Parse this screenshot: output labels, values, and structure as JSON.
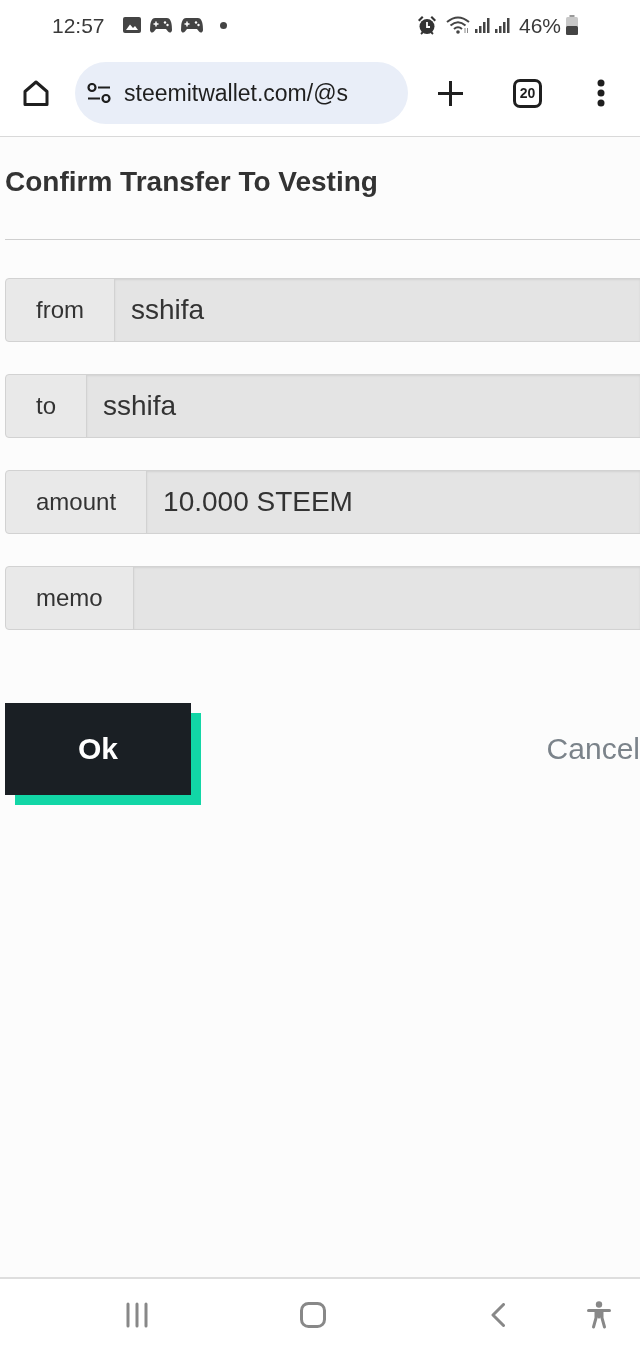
{
  "status_bar": {
    "time": "12:57",
    "battery": "46%"
  },
  "browser_toolbar": {
    "url": "steemitwallet.com/@s",
    "tab_count": "20"
  },
  "dialog": {
    "title": "Confirm Transfer To Vesting",
    "fields": [
      {
        "label": "from",
        "value": "sshifa"
      },
      {
        "label": "to",
        "value": "sshifa"
      },
      {
        "label": "amount",
        "value": "10.000 STEEM"
      },
      {
        "label": "memo"
      }
    ],
    "buttons": [
      {
        "kind": "primary",
        "label": "Ok"
      },
      {
        "kind": "link",
        "label": "Cancel"
      }
    ]
  }
}
